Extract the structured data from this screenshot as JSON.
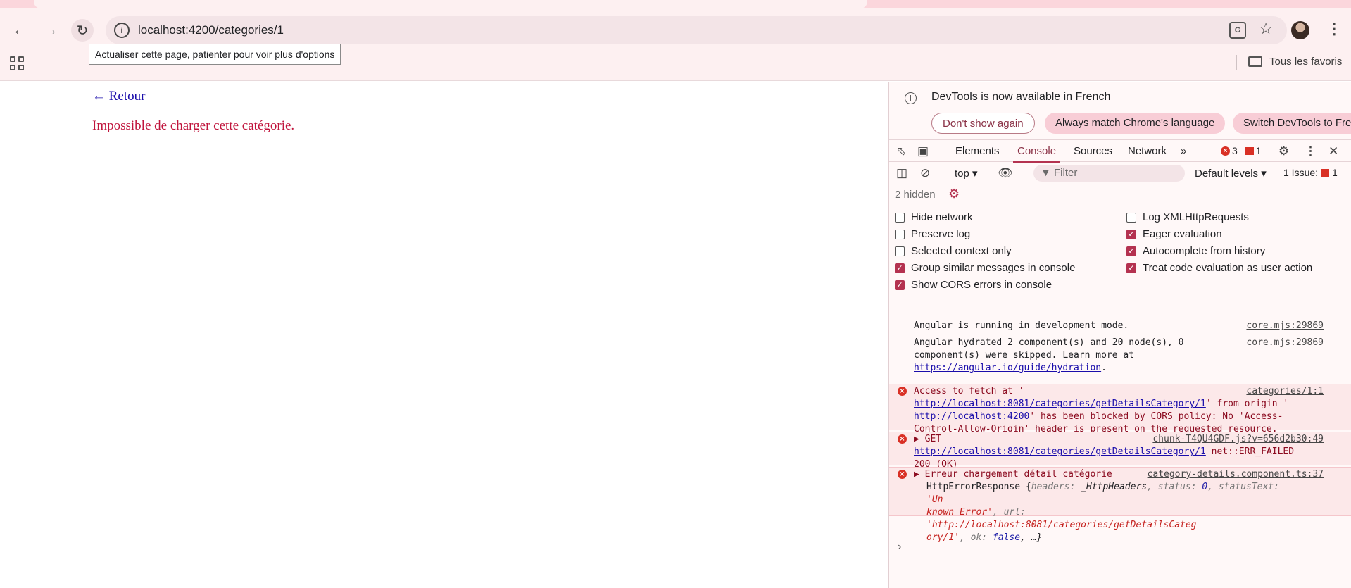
{
  "browser": {
    "url": "localhost:4200/categories/1",
    "tooltip": "Actualiser cette page, patienter pour voir plus d'options",
    "bookmarks_all": "Tous les favoris"
  },
  "page": {
    "back_link": "← Retour",
    "error_message": "Impossible de charger cette catégorie."
  },
  "devtools": {
    "infobar": {
      "message": "DevTools is now available in French",
      "btn_dont_show": "Don't show again",
      "btn_always_match": "Always match Chrome's language",
      "btn_switch": "Switch DevTools to Fre"
    },
    "tabs": {
      "elements": "Elements",
      "console": "Console",
      "sources": "Sources",
      "network": "Network",
      "more": "»",
      "error_count": "3",
      "issue_count": "1"
    },
    "toolbar": {
      "context": "top ▾",
      "filter_placeholder": "Filter",
      "levels": "Default levels ▾",
      "issues_label": "1 Issue:",
      "issues_count": "1"
    },
    "hidden": "2 hidden",
    "settings": {
      "hide_network": "Hide network",
      "preserve_log": "Preserve log",
      "selected_context": "Selected context only",
      "group_similar": "Group similar messages in console",
      "show_cors": "Show CORS errors in console",
      "log_xhr": "Log XMLHttpRequests",
      "eager_eval": "Eager evaluation",
      "autocomplete": "Autocomplete from history",
      "treat_code": "Treat code evaluation as user action"
    },
    "logs": {
      "m1_text": "Angular is running in development mode.",
      "m1_src": "core.mjs:29869",
      "m2_text": "Angular hydrated 2 component(s) and 20 node(s), 0\ncomponent(s) were skipped. Learn more at",
      "m2_link": "https://angular.io/guide/hydration",
      "m2_src": "core.mjs:29869",
      "e1_a": "Access to fetch at '",
      "e1_link1": "http://localhost:8081/categories/getDetailsCategory/1",
      "e1_b": "' from origin '",
      "e1_link2": "http://localhost:4200",
      "e1_c": "' has been blocked by CORS policy: No 'Access-\nControl-Allow-Origin' header is present on the requested resource.",
      "e1_src": "categories/1:1",
      "e2_get": "▶ GET",
      "e2_link": "http://localhost:8081/categories/getDetailsCategory/1",
      "e2_tail": " net::ERR_FAILED\n200 (OK)",
      "e2_src": "chunk-T4QU4GDF.js?v=656d2b30:49",
      "e3_title": "▶ Erreur chargement détail catégorie",
      "e3_src": "category-details.component.ts:37",
      "e3_obj": "HttpErrorResponse {",
      "e3_h": "headers: ",
      "e3_hv": "_HttpHeaders",
      "e3_s": ", status: ",
      "e3_sv": "0",
      "e3_st": ", statusText: ",
      "e3_stv": "'Un\nknown Error'",
      "e3_u": ", url: ",
      "e3_uv": "'http://localhost:8081/categories/getDetailsCateg\nory/1'",
      "e3_ok": ", ok: ",
      "e3_okv": "false",
      "e3_end": ", …}"
    }
  }
}
